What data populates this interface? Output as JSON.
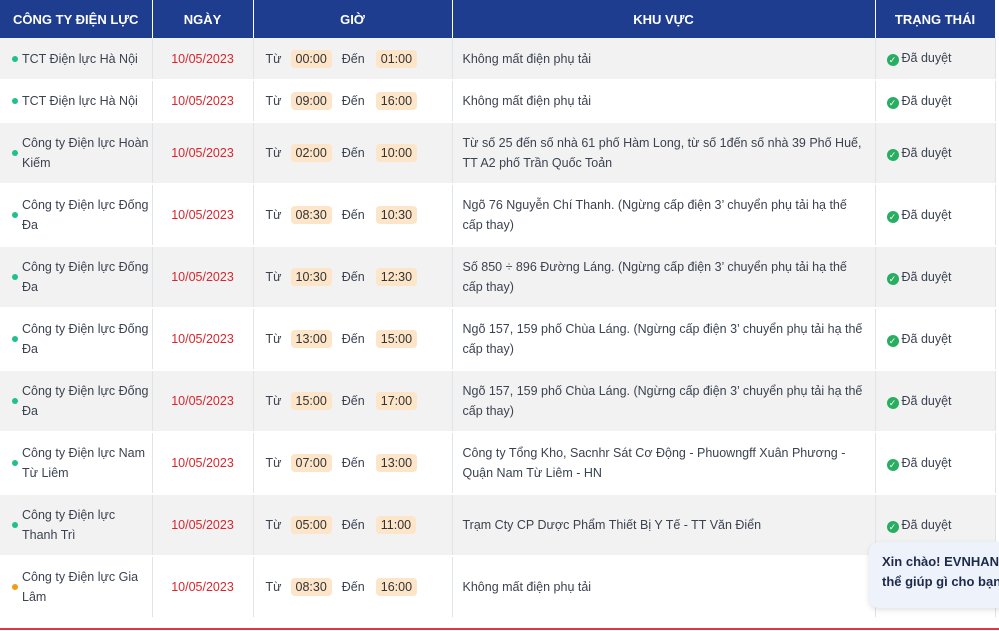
{
  "headers": [
    "CÔNG TY ĐIỆN LỰC",
    "NGÀY",
    "GIỜ",
    "KHU VỰC",
    "TRẠNG THÁI"
  ],
  "time_labels": {
    "from": "Từ",
    "to": "Đến"
  },
  "status_colors": {
    "green": "#1fbf8f",
    "orange": "#f39c12"
  },
  "rows": [
    {
      "company": "TCT Điện lực Hà Nội",
      "dot": "green",
      "date": "10/05/2023",
      "from": "00:00",
      "to": "01:00",
      "area": "Không mất điện phụ tải",
      "status": "Đã duyệt"
    },
    {
      "company": "TCT Điện lực Hà Nội",
      "dot": "green",
      "date": "10/05/2023",
      "from": "09:00",
      "to": "16:00",
      "area": "Không mất điện phụ tải",
      "status": "Đã duyệt"
    },
    {
      "company": "Công ty Điện lực Hoàn Kiếm",
      "dot": "green",
      "date": "10/05/2023",
      "from": "02:00",
      "to": "10:00",
      "area": "Từ số 25 đến số nhà 61 phố Hàm Long, từ số 1đến số nhà 39 Phố Huế, TT A2 phố Trần Quốc Toản",
      "status": "Đã duyệt"
    },
    {
      "company": "Công ty Điện lực Đống Đa",
      "dot": "green",
      "date": "10/05/2023",
      "from": "08:30",
      "to": "10:30",
      "area": "Ngõ 76 Nguyễn Chí Thanh. (Ngừng cấp điện 3’ chuyển phụ tải hạ thế cấp thay)",
      "status": "Đã duyệt"
    },
    {
      "company": "Công ty Điện lực Đống Đa",
      "dot": "green",
      "date": "10/05/2023",
      "from": "10:30",
      "to": "12:30",
      "area": "Số 850 ÷ 896 Đường Láng. (Ngừng cấp điện 3’ chuyển phụ tải hạ thế cấp thay)",
      "status": "Đã duyệt"
    },
    {
      "company": "Công ty Điện lực Đống Đa",
      "dot": "green",
      "date": "10/05/2023",
      "from": "13:00",
      "to": "15:00",
      "area": "Ngõ 157, 159 phố Chùa Láng. (Ngừng cấp điện 3’ chuyển phụ tải hạ thế cấp thay)",
      "status": "Đã duyệt"
    },
    {
      "company": "Công ty Điện lực Đống Đa",
      "dot": "green",
      "date": "10/05/2023",
      "from": "15:00",
      "to": "17:00",
      "area": "Ngõ 157, 159 phố Chùa Láng. (Ngừng cấp điện 3’ chuyển phụ tải hạ thế cấp thay)",
      "status": "Đã duyệt"
    },
    {
      "company": "Công ty Điện lực Nam Từ Liêm",
      "dot": "green",
      "date": "10/05/2023",
      "from": "07:00",
      "to": "13:00",
      "area": "Công ty Tổng Kho, Sacnhr Sát Cơ Động - Phuowngff Xuân Phương - Quận Nam Từ Liêm - HN",
      "status": "Đã duyệt"
    },
    {
      "company": "Công ty Điện lực Thanh Trì",
      "dot": "green",
      "date": "10/05/2023",
      "from": "05:00",
      "to": "11:00",
      "area": "Trạm Cty CP Dược Phẩm Thiết Bị Y Tế - TT Văn Điển",
      "status": "Đã duyệt"
    },
    {
      "company": "Công ty Điện lực Gia Lâm",
      "dot": "orange",
      "date": "10/05/2023",
      "from": "08:30",
      "to": "16:00",
      "area": "Không mất điện phụ tải",
      "status": ""
    }
  ],
  "chat": {
    "line1": "Xin chào! EVNHANO",
    "line2": "thể giúp gì cho bạn"
  }
}
